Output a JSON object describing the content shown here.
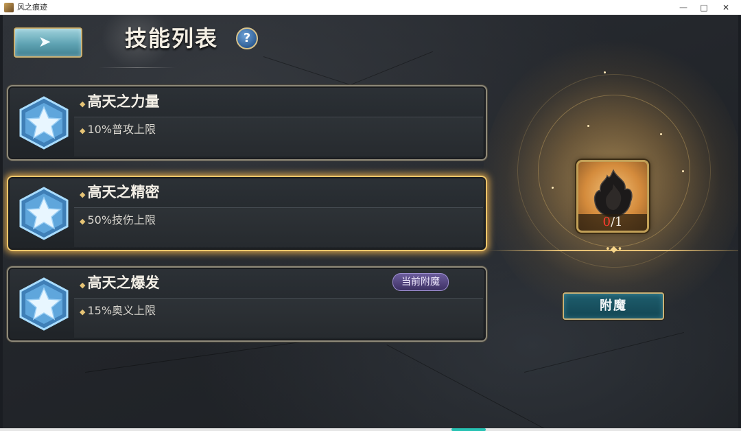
{
  "window": {
    "title": "风之痕迹",
    "minimize": "—",
    "maximize": "□",
    "close": "✕"
  },
  "header": {
    "back_icon": "back-arrow-icon",
    "title": "技能列表",
    "help_label": "?"
  },
  "skills": [
    {
      "name": "高天之力量",
      "desc": "10%普攻上限",
      "selected": false,
      "badge": ""
    },
    {
      "name": "高天之精密",
      "desc": "50%技伤上限",
      "selected": true,
      "badge": ""
    },
    {
      "name": "高天之爆发",
      "desc": "15%奥义上限",
      "selected": false,
      "badge": "当前附魔"
    }
  ],
  "item": {
    "icon": "dark-flame-icon",
    "have": "0",
    "sep": "/",
    "need": "1"
  },
  "actions": {
    "enchant_label": "附魔"
  },
  "colors": {
    "accent_gold": "#f1c76b",
    "count_red": "#ff3b30",
    "badge_purple": "#6c5d9c",
    "button_teal": "#1e5d6d"
  }
}
